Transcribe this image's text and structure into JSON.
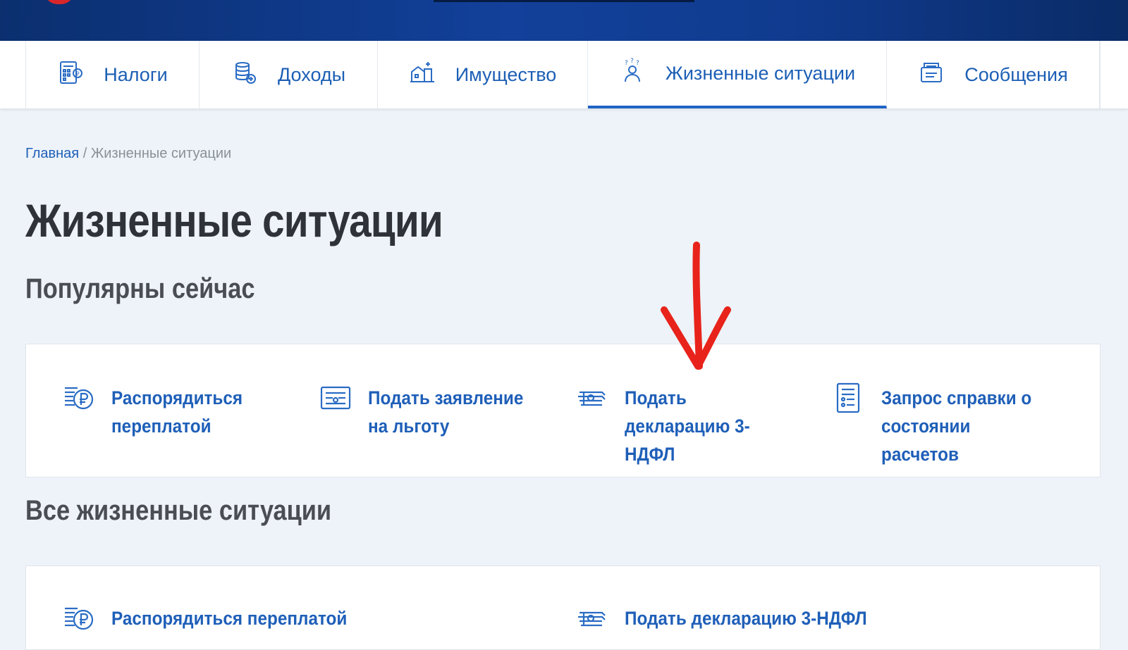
{
  "nav": {
    "tabs": [
      {
        "label": "Налоги",
        "icon": "calculator-icon"
      },
      {
        "label": "Доходы",
        "icon": "coins-icon"
      },
      {
        "label": "Имущество",
        "icon": "property-icon"
      },
      {
        "label": "Жизненные ситуации",
        "icon": "person-question-icon",
        "active": true
      },
      {
        "label": "Сообщения",
        "icon": "message-icon"
      }
    ]
  },
  "breadcrumb": {
    "home": "Главная",
    "separator": "/",
    "current": "Жизненные ситуации"
  },
  "page": {
    "title": "Жизненные ситуации"
  },
  "popular": {
    "heading": "Популярны сейчас",
    "items": [
      {
        "label": "Распорядиться переплатой",
        "icon": "ruble-refund-icon"
      },
      {
        "label": "Подать заявление на льготу",
        "icon": "certificate-icon"
      },
      {
        "label": "Подать декларацию 3-НДФЛ",
        "icon": "declaration-icon"
      },
      {
        "label": "Запрос справки о состоянии расчетов",
        "icon": "document-list-icon"
      }
    ]
  },
  "all": {
    "heading": "Все жизненные ситуации",
    "items": [
      {
        "label": "Распорядиться переплатой",
        "icon": "ruble-refund-icon"
      },
      {
        "label": "Подать декларацию 3-НДФЛ",
        "icon": "declaration-icon"
      }
    ]
  },
  "colors": {
    "accent": "#1f5fb8",
    "header": "#12409a",
    "annotation": "#e8231b"
  }
}
